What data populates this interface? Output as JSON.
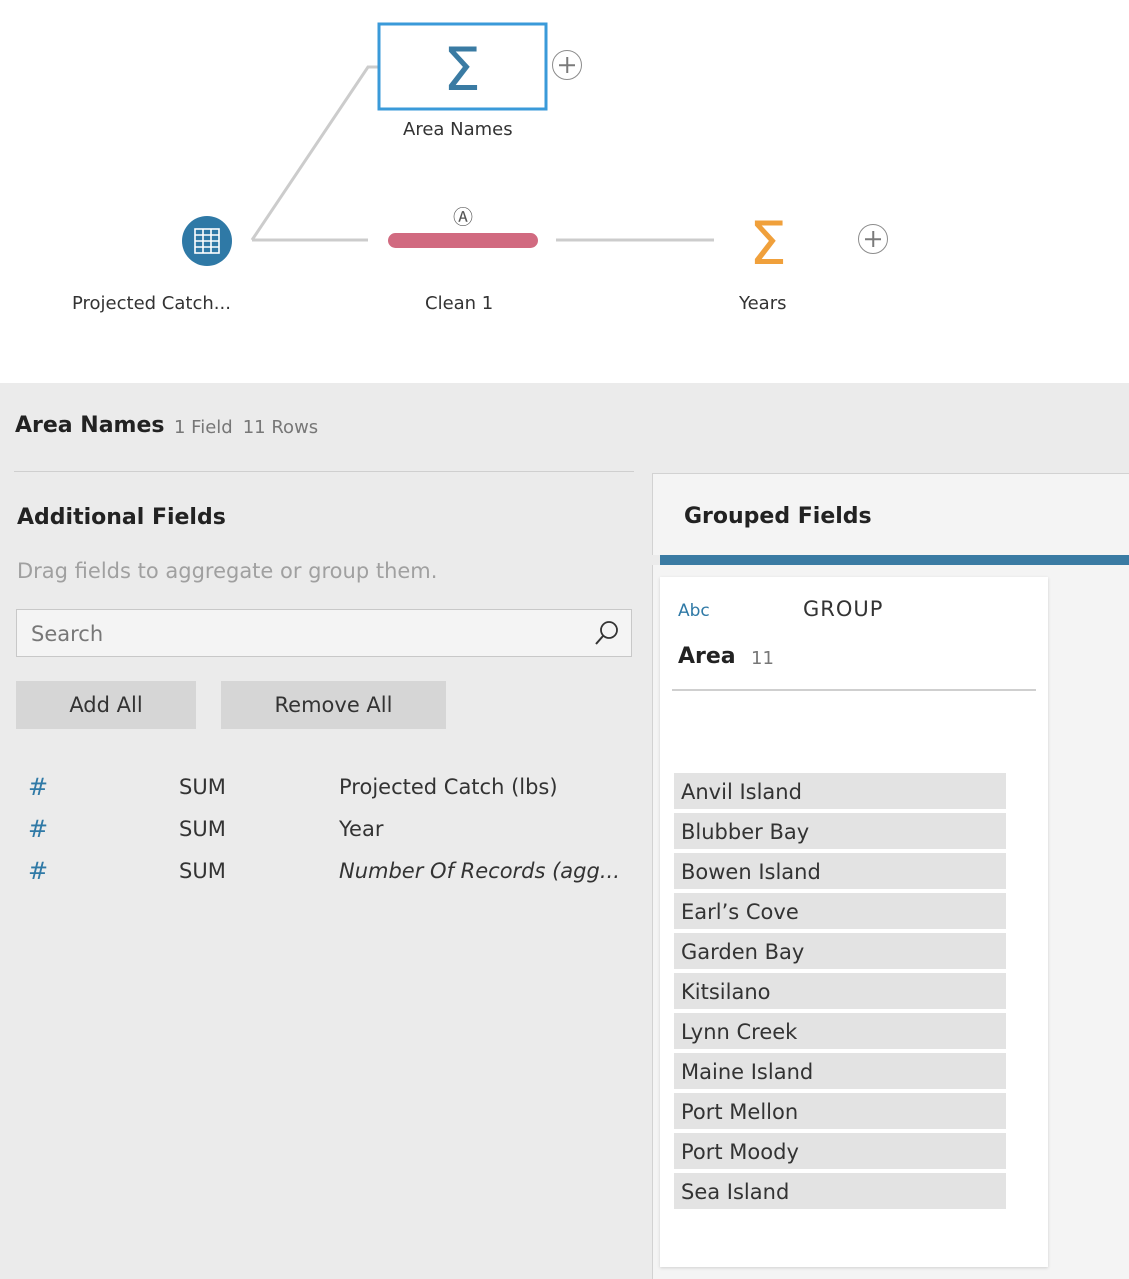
{
  "flow": {
    "nodes": {
      "input": {
        "label": "Projected Catch..."
      },
      "aggregate_selected": {
        "label": "Area Names"
      },
      "clean": {
        "label": "Clean 1"
      },
      "aggregate_years": {
        "label": "Years"
      }
    },
    "colors": {
      "input": "#2f79a6",
      "aggregate_selected": "#3a7ba3",
      "clean": "#d16a80",
      "aggregate_years": "#f0a03b",
      "connector": "#cccccc"
    }
  },
  "step": {
    "title": "Area Names",
    "field_count": "1 Field",
    "row_count": "11 Rows"
  },
  "additional_fields": {
    "title": "Additional Fields",
    "hint": "Drag fields to aggregate or group them.",
    "search_placeholder": "Search",
    "add_all_label": "Add All",
    "remove_all_label": "Remove All",
    "fields": [
      {
        "type_icon": "#",
        "aggregation": "SUM",
        "name": "Projected Catch (lbs)"
      },
      {
        "type_icon": "#",
        "aggregation": "SUM",
        "name": "Year"
      },
      {
        "type_icon": "#",
        "aggregation": "SUM",
        "name": "Number Of Records (agg..."
      }
    ]
  },
  "grouped_fields": {
    "title": "Grouped Fields",
    "card": {
      "type_badge": "Abc",
      "role": "GROUP",
      "field_name": "Area",
      "count": "11",
      "values": [
        "Anvil Island",
        "Blubber Bay",
        "Bowen Island",
        "Earl’s Cove",
        "Garden Bay",
        "Kitsilano",
        "Lynn Creek",
        "Maine Island",
        "Port Mellon",
        "Port Moody",
        "Sea Island"
      ]
    }
  }
}
